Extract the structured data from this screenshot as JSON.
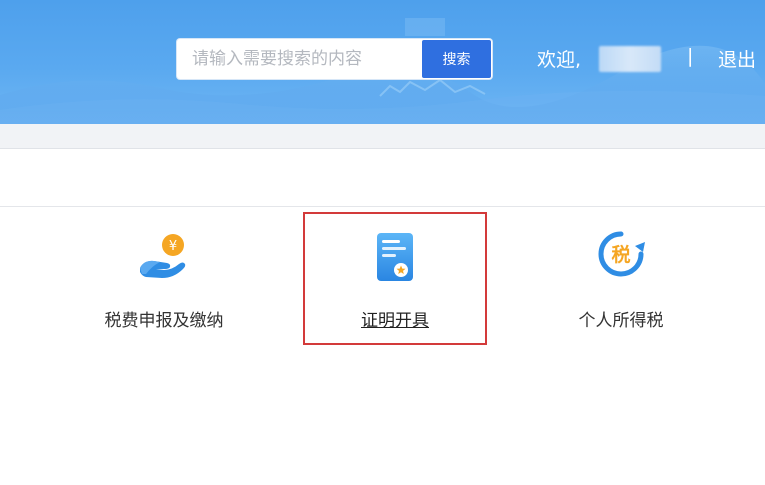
{
  "header": {
    "search": {
      "placeholder": "请输入需要搜索的内容",
      "button_label": "搜索"
    },
    "welcome_text": "欢迎,",
    "separator": "|",
    "logout_label": "退出"
  },
  "services": [
    {
      "label": "税费申报及缴纳",
      "icon": "hand-coin-icon"
    },
    {
      "label": "证明开具",
      "icon": "certificate-icon"
    },
    {
      "label": "个人所得税",
      "icon": "tax-refresh-icon"
    }
  ],
  "colors": {
    "header_top": "#4ea0ec",
    "search_button": "#2f6fe0",
    "highlight_border": "#d33a3a",
    "icon_blue": "#2f8de4",
    "icon_orange": "#f5a623"
  }
}
